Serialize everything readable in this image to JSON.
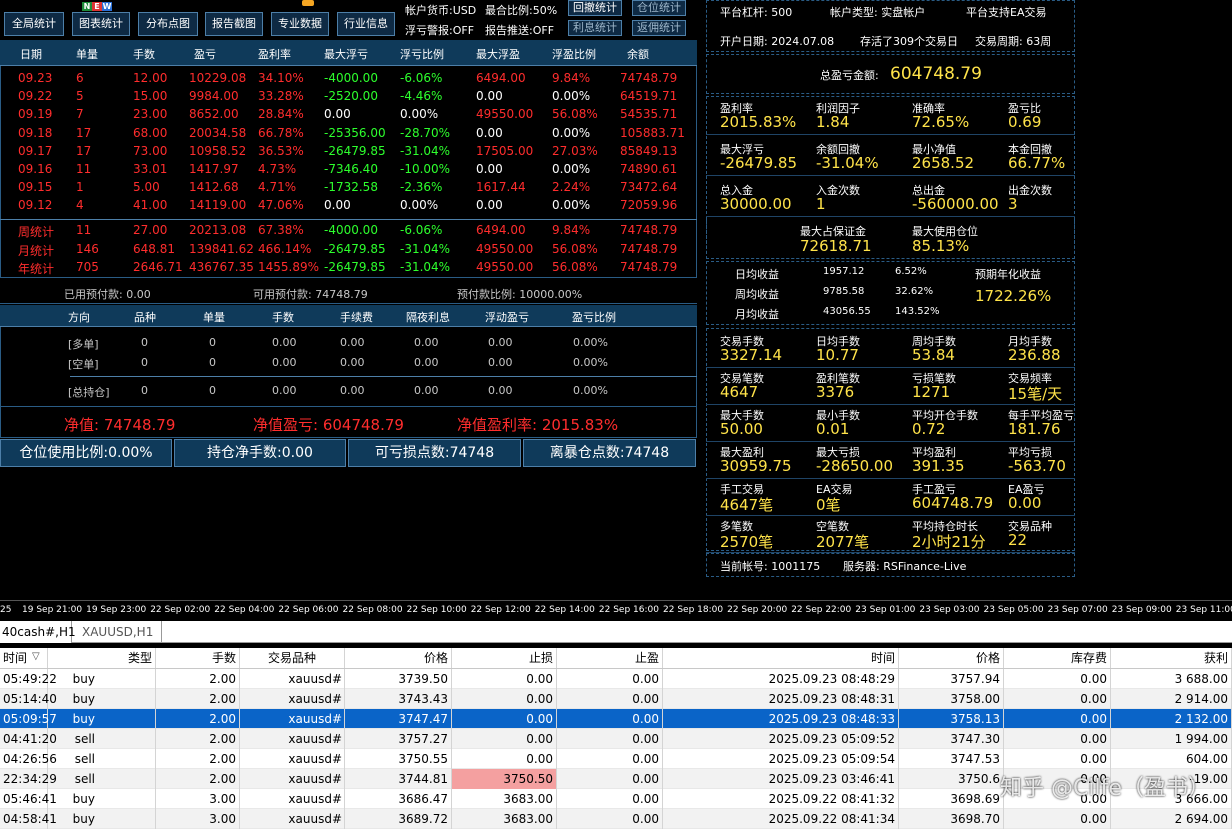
{
  "toolbar": {
    "btn1": "全局统计",
    "btn2": "图表统计",
    "btn3": "分布点图",
    "btn4": "报告截图",
    "btn5": "专业数据",
    "btn6": "行业信息",
    "new_badge": [
      "N",
      "E",
      "W"
    ],
    "currency": "帐户货币:USD",
    "max_ratio": "最合比例:50%",
    "float_alert": "浮亏警报:OFF",
    "report_push": "报告推送:OFF",
    "s1": "回撤统计",
    "s2": "仓位统计",
    "s3": "利息统计",
    "s4": "返佣统计"
  },
  "table": {
    "headers": [
      "日期",
      "单量",
      "手数",
      "盈亏",
      "盈利率",
      "最大浮亏",
      "浮亏比例",
      "最大浮盈",
      "浮盈比例",
      "余额"
    ],
    "rows": [
      [
        "09.23",
        "6",
        "12.00",
        "10229.08",
        "34.10%",
        "-4000.00",
        "-6.06%",
        "6494.00",
        "9.84%",
        "74748.79"
      ],
      [
        "09.22",
        "5",
        "15.00",
        "9984.00",
        "33.28%",
        "-2520.00",
        "-4.46%",
        "0.00",
        "0.00%",
        "64519.71"
      ],
      [
        "09.19",
        "7",
        "23.00",
        "8652.00",
        "28.84%",
        "0.00",
        "0.00%",
        "49550.00",
        "56.08%",
        "54535.71"
      ],
      [
        "09.18",
        "17",
        "68.00",
        "20034.58",
        "66.78%",
        "-25356.00",
        "-28.70%",
        "0.00",
        "0.00%",
        "105883.71"
      ],
      [
        "09.17",
        "17",
        "73.00",
        "10958.52",
        "36.53%",
        "-26479.85",
        "-31.04%",
        "17505.00",
        "27.03%",
        "85849.13"
      ],
      [
        "09.16",
        "11",
        "33.01",
        "1417.97",
        "4.73%",
        "-7346.40",
        "-10.00%",
        "0.00",
        "0.00%",
        "74890.61"
      ],
      [
        "09.15",
        "1",
        "5.00",
        "1412.68",
        "4.71%",
        "-1732.58",
        "-2.36%",
        "1617.44",
        "2.24%",
        "73472.64"
      ],
      [
        "09.12",
        "4",
        "41.00",
        "14119.00",
        "47.06%",
        "0.00",
        "0.00%",
        "0.00",
        "0.00%",
        "72059.96"
      ]
    ],
    "summary": [
      [
        "周统计",
        "11",
        "27.00",
        "20213.08",
        "67.38%",
        "-4000.00",
        "-6.06%",
        "6494.00",
        "9.84%",
        "74748.79"
      ],
      [
        "月统计",
        "146",
        "648.81",
        "139841.62",
        "466.14%",
        "-26479.85",
        "-31.04%",
        "49550.00",
        "56.08%",
        "74748.79"
      ],
      [
        "年统计",
        "705",
        "2646.71",
        "436767.35",
        "1455.89%",
        "-26479.85",
        "-31.04%",
        "49550.00",
        "56.08%",
        "74748.79"
      ]
    ]
  },
  "prepay": {
    "used": "已用预付款: 0.00",
    "avail": "可用预付款: 74748.79",
    "ratio": "预付款比例: 10000.00%"
  },
  "positions": {
    "headers": [
      "方向",
      "品种",
      "单量",
      "手数",
      "手续费",
      "隔夜利息",
      "浮动盈亏",
      "盈亏比例"
    ],
    "rows": [
      [
        "[多单]",
        "0",
        "0",
        "0.00",
        "0.00",
        "0.00",
        "0.00",
        "0.00%"
      ],
      [
        "[空单]",
        "0",
        "0",
        "0.00",
        "0.00",
        "0.00",
        "0.00",
        "0.00%"
      ],
      [
        "[总持仓]",
        "0",
        "0",
        "0.00",
        "0.00",
        "0.00",
        "0.00",
        "0.00%"
      ]
    ]
  },
  "equity": {
    "net": "净值: 74748.79",
    "pnl": "净值盈亏: 604748.79",
    "rate": "净值盈利率: 2015.83%"
  },
  "bottom_buttons": [
    "仓位使用比例:0.00%",
    "持仓净手数:0.00",
    "可亏损点数:74748",
    "离暴仓点数:74748"
  ],
  "right": {
    "leverage": "平台杠杆: 500",
    "acct_type": "帐户类型: 实盘帐户",
    "ea": "平台支持EA交易",
    "open_date": "开户日期: 2024.07.08",
    "survived": "存活了309个交易日",
    "period": "交易周期: 63周",
    "total_label": "总盈亏金额:",
    "total_value": "604748.79",
    "g1": [
      [
        "盈利率",
        "2015.83%"
      ],
      [
        "利润因子",
        "1.84"
      ],
      [
        "准确率",
        "72.65%"
      ],
      [
        "盈亏比",
        "0.69"
      ]
    ],
    "g2": [
      [
        "最大浮亏",
        "-26479.85"
      ],
      [
        "余额回撤",
        "-31.04%"
      ],
      [
        "最小净值",
        "2658.52"
      ],
      [
        "本金回撤",
        "66.77%"
      ]
    ],
    "g3": [
      [
        "总入金",
        "30000.00"
      ],
      [
        "入金次数",
        "1"
      ],
      [
        "总出金",
        "-560000.00"
      ],
      [
        "出金次数",
        "3"
      ]
    ],
    "margin_label": "最大占保证金",
    "margin_value": "72618.71",
    "pos_label": "最大使用仓位",
    "pos_value": "85.13%",
    "income": [
      [
        "日均收益",
        "1957.12",
        "6.52%"
      ],
      [
        "周均收益",
        "9785.58",
        "32.62%"
      ],
      [
        "月均收益",
        "43056.55",
        "143.52%"
      ]
    ],
    "annual_label": "预期年化收益",
    "annual_value": "1722.26%",
    "g4": [
      [
        "交易手数",
        "3327.14"
      ],
      [
        "日均手数",
        "10.77"
      ],
      [
        "周均手数",
        "53.84"
      ],
      [
        "月均手数",
        "236.88"
      ]
    ],
    "g5": [
      [
        "交易笔数",
        "4647"
      ],
      [
        "盈利笔数",
        "3376"
      ],
      [
        "亏损笔数",
        "1271"
      ],
      [
        "交易频率",
        "15笔/天"
      ]
    ],
    "g6": [
      [
        "最大手数",
        "50.00"
      ],
      [
        "最小手数",
        "0.01"
      ],
      [
        "平均开仓手数",
        "0.72"
      ],
      [
        "每手平均盈亏",
        "181.76"
      ]
    ],
    "g7": [
      [
        "最大盈利",
        "30959.75"
      ],
      [
        "最大亏损",
        "-28650.00"
      ],
      [
        "平均盈利",
        "391.35"
      ],
      [
        "平均亏损",
        "-563.70"
      ]
    ],
    "g8": [
      [
        "手工交易",
        "4647笔"
      ],
      [
        "EA交易",
        "0笔"
      ],
      [
        "手工盈亏",
        "604748.79"
      ],
      [
        "EA盈亏",
        "0.00"
      ]
    ],
    "g9": [
      [
        "多笔数",
        "2570笔"
      ],
      [
        "空笔数",
        "2077笔"
      ],
      [
        "平均持仓时长",
        "2小时21分"
      ],
      [
        "交易品种",
        "22"
      ]
    ],
    "account": "当前帐号: 1001175",
    "server": "服务器: RSFinance-Live"
  },
  "timeline": [
    "25",
    "19 Sep 21:00",
    "19 Sep 23:00",
    "22 Sep 02:00",
    "22 Sep 04:00",
    "22 Sep 06:00",
    "22 Sep 08:00",
    "22 Sep 10:00",
    "22 Sep 12:00",
    "22 Sep 14:00",
    "22 Sep 16:00",
    "22 Sep 18:00",
    "22 Sep 20:00",
    "22 Sep 22:00",
    "23 Sep 01:00",
    "23 Sep 03:00",
    "23 Sep 05:00",
    "23 Sep 07:00",
    "23 Sep 09:00",
    "23 Sep 11:00"
  ],
  "tabs": [
    "40cash#,H1",
    "XAUUSD,H1"
  ],
  "orders": {
    "headers": [
      "时间",
      "类型",
      "手数",
      "交易品种",
      "价格",
      "止损",
      "止盈",
      "时间",
      "价格",
      "库存费",
      "获利"
    ],
    "rows": [
      [
        "05:49:22",
        "buy",
        "2.00",
        "xauusd#",
        "3739.50",
        "0.00",
        "0.00",
        "2025.09.23 08:48:29",
        "3757.94",
        "0.00",
        "3 688.00"
      ],
      [
        "05:14:40",
        "buy",
        "2.00",
        "xauusd#",
        "3743.43",
        "0.00",
        "0.00",
        "2025.09.23 08:48:31",
        "3758.00",
        "0.00",
        "2 914.00"
      ],
      [
        "05:09:57",
        "buy",
        "2.00",
        "xauusd#",
        "3747.47",
        "0.00",
        "0.00",
        "2025.09.23 08:48:33",
        "3758.13",
        "0.00",
        "2 132.00"
      ],
      [
        "04:41:20",
        "sell",
        "2.00",
        "xauusd#",
        "3757.27",
        "0.00",
        "0.00",
        "2025.09.23 05:09:52",
        "3747.30",
        "0.00",
        "1 994.00"
      ],
      [
        "04:26:56",
        "sell",
        "2.00",
        "xauusd#",
        "3750.55",
        "0.00",
        "0.00",
        "2025.09.23 05:09:54",
        "3747.53",
        "0.00",
        "604.00"
      ],
      [
        "22:34:29",
        "sell",
        "2.00",
        "xauusd#",
        "3744.81",
        "3750.50",
        "0.00",
        "2025.09.23 03:46:41",
        "3750.6",
        "0.00",
        "-19.00"
      ],
      [
        "05:46:41",
        "buy",
        "3.00",
        "xauusd#",
        "3686.47",
        "3683.00",
        "0.00",
        "2025.09.22 08:41:32",
        "3698.69",
        "0.00",
        "3 666.00"
      ],
      [
        "04:58:41",
        "buy",
        "3.00",
        "xauusd#",
        "3689.72",
        "3683.00",
        "0.00",
        "2025.09.22 08:41:34",
        "3698.70",
        "0.00",
        "2 694.00"
      ]
    ]
  },
  "watermark": "知乎 @Cilfe（盈书）"
}
